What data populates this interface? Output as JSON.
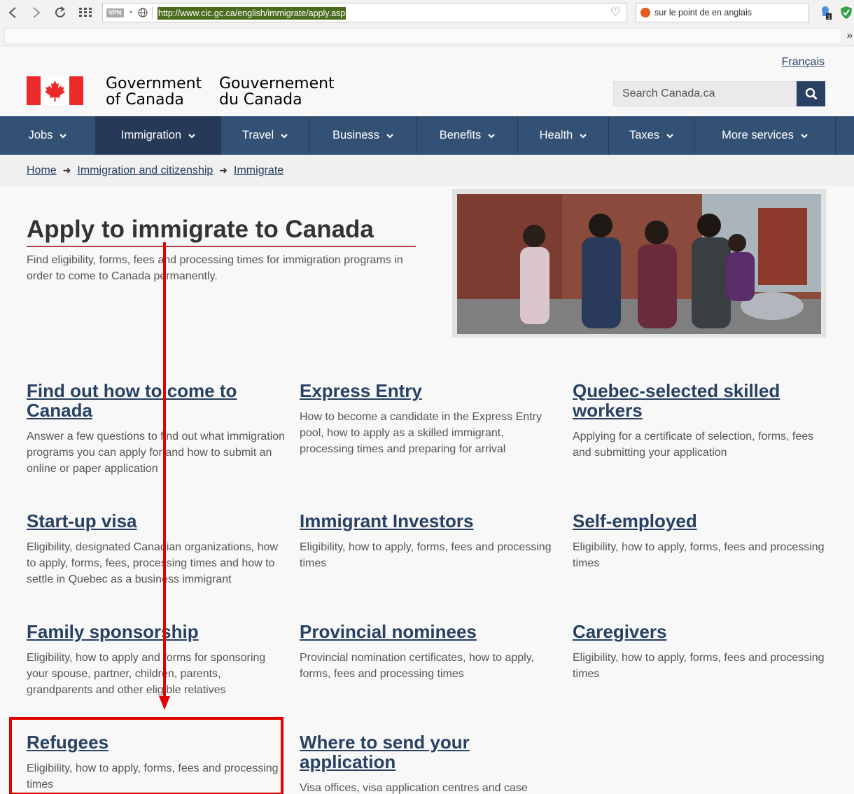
{
  "browser": {
    "vpn_label": "VPN",
    "url": "http://www.cic.gc.ca/english/immigrate/apply.asp",
    "translate_text": "sur le point de en anglais",
    "extension_badge": "3"
  },
  "header": {
    "language_link": "Français",
    "gov_en_line1": "Government",
    "gov_en_line2": "of Canada",
    "gov_fr_line1": "Gouvernement",
    "gov_fr_line2": "du Canada",
    "search_placeholder": "Search Canada.ca"
  },
  "menu": {
    "items": [
      {
        "label": "Jobs"
      },
      {
        "label": "Immigration"
      },
      {
        "label": "Travel"
      },
      {
        "label": "Business"
      },
      {
        "label": "Benefits"
      },
      {
        "label": "Health"
      },
      {
        "label": "Taxes"
      },
      {
        "label": "More services"
      }
    ]
  },
  "breadcrumb": {
    "items": [
      "Home",
      "Immigration and citizenship",
      "Immigrate"
    ]
  },
  "main": {
    "title": "Apply to immigrate to Canada",
    "intro": "Find eligibility, forms, fees and processing times for immigration programs in order to come to Canada permanently.",
    "cards": [
      {
        "title": "Find out how to come to Canada",
        "desc": "Answer a few questions to find out what immigration programs you can apply for and how to submit an online or paper application"
      },
      {
        "title": "Express Entry",
        "desc": "How to become a candidate in the Express Entry pool, how to apply as a skilled immigrant, processing times and preparing for arrival"
      },
      {
        "title": "Quebec-selected skilled workers",
        "desc": "Applying for a certificate of selection, forms, fees and submitting your application"
      },
      {
        "title": "Start-up visa",
        "desc": "Eligibility, designated Canadian organizations, how to apply, forms, fees, processing times and how to settle in Quebec as a business immigrant"
      },
      {
        "title": "Immigrant Investors",
        "desc": "Eligibility, how to apply, forms, fees and processing times"
      },
      {
        "title": "Self-employed",
        "desc": "Eligibility, how to apply, forms, fees and processing times"
      },
      {
        "title": "Family sponsorship",
        "desc": "Eligibility, how to apply and forms for sponsoring your spouse, partner, children, parents, grandparents and other eligible relatives"
      },
      {
        "title": "Provincial nominees",
        "desc": "Provincial nomination certificates, how to apply, forms, fees and processing times"
      },
      {
        "title": "Caregivers",
        "desc": "Eligibility, how to apply, forms, fees and processing times"
      },
      {
        "title": "Refugees",
        "desc": "Eligibility, how to apply, forms, fees and processing times"
      },
      {
        "title": "Where to send your application",
        "desc": "Visa offices, visa application centres and case"
      }
    ]
  },
  "colors": {
    "menu_bg": "#335075",
    "link": "#284162",
    "highlight": "#e00000",
    "flag_red": "#ea2a2a"
  }
}
